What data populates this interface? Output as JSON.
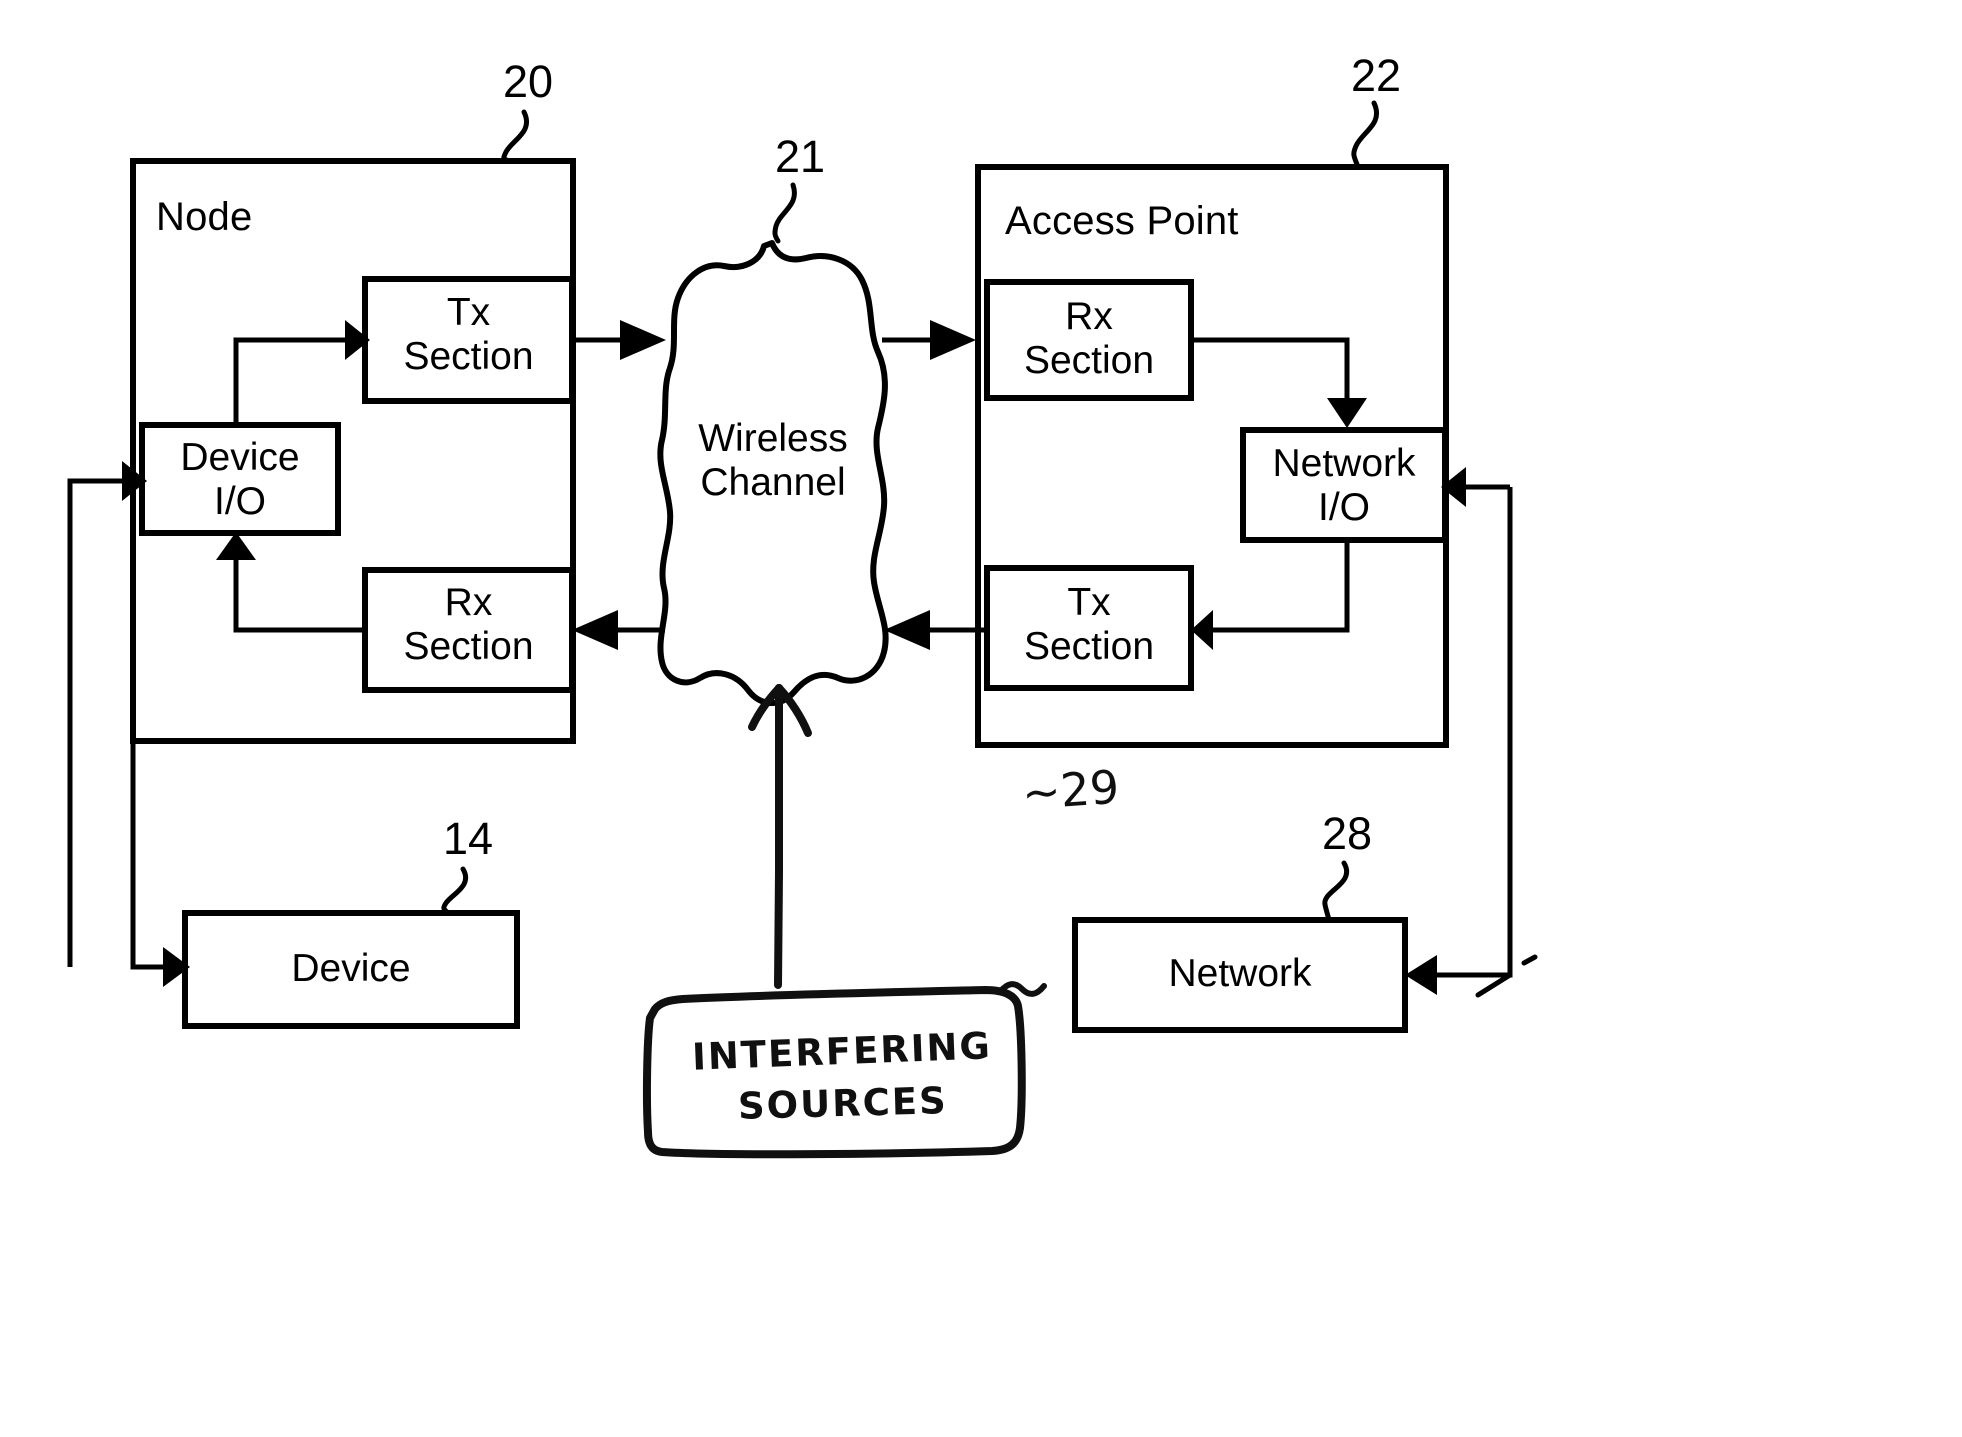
{
  "figure": {
    "type": "block-diagram",
    "background_color": "#ffffff",
    "line_color": "#000000",
    "annotation_color": "#101010"
  },
  "blocks": {
    "node": {
      "label": "Node",
      "ref": "20"
    },
    "node_tx": {
      "label_line1": "Tx",
      "label_line2": "Section"
    },
    "node_rx": {
      "label_line1": "Rx",
      "label_line2": "Section"
    },
    "device_io": {
      "label_line1": "Device",
      "label_line2": "I/O"
    },
    "channel": {
      "label_line1": "Wireless",
      "label_line2": "Channel",
      "ref": "21"
    },
    "access_point": {
      "label": "Access Point",
      "ref": "22"
    },
    "ap_rx": {
      "label_line1": "Rx",
      "label_line2": "Section"
    },
    "ap_tx": {
      "label_line1": "Tx",
      "label_line2": "Section"
    },
    "network_io": {
      "label_line1": "Network",
      "label_line2": "I/O"
    },
    "device": {
      "label": "Device",
      "ref": "14"
    },
    "network": {
      "label": "Network",
      "ref": "28"
    }
  },
  "annotations": {
    "interfering_sources": {
      "line1": "INTERFERING",
      "line2": "SOURCES",
      "ref": "~29",
      "style": "handwritten"
    }
  },
  "reference_numerals": [
    "20",
    "21",
    "22",
    "14",
    "28",
    "29"
  ]
}
